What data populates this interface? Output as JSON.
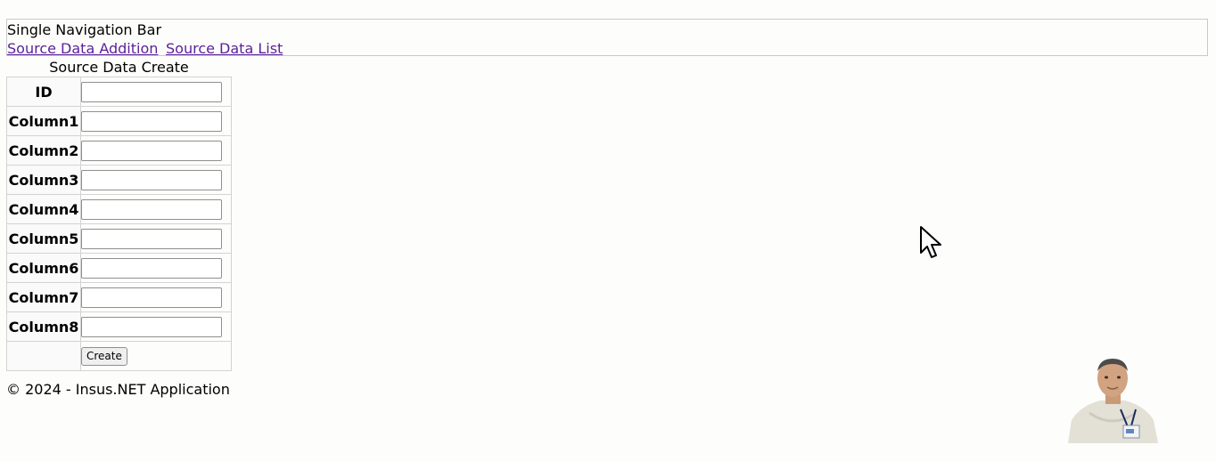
{
  "nav": {
    "title": "Single Navigation Bar",
    "links": [
      "Source Data Addition",
      "Source Data List"
    ]
  },
  "form": {
    "caption": "Source Data Create",
    "fields": [
      {
        "label": "ID",
        "value": ""
      },
      {
        "label": "Column1",
        "value": ""
      },
      {
        "label": "Column2",
        "value": ""
      },
      {
        "label": "Column3",
        "value": ""
      },
      {
        "label": "Column4",
        "value": ""
      },
      {
        "label": "Column5",
        "value": ""
      },
      {
        "label": "Column6",
        "value": ""
      },
      {
        "label": "Column7",
        "value": ""
      },
      {
        "label": "Column8",
        "value": ""
      }
    ],
    "submit_label": "Create"
  },
  "footer": {
    "text": "© 2024 - Insus.NET Application"
  },
  "overlay": {
    "cursor_icon": "mouse-pointer-icon",
    "avatar": "presenter-avatar"
  },
  "colors": {
    "link": "#5a1f9a",
    "border": "#d3d3d3",
    "background": "#fdfdfc"
  }
}
